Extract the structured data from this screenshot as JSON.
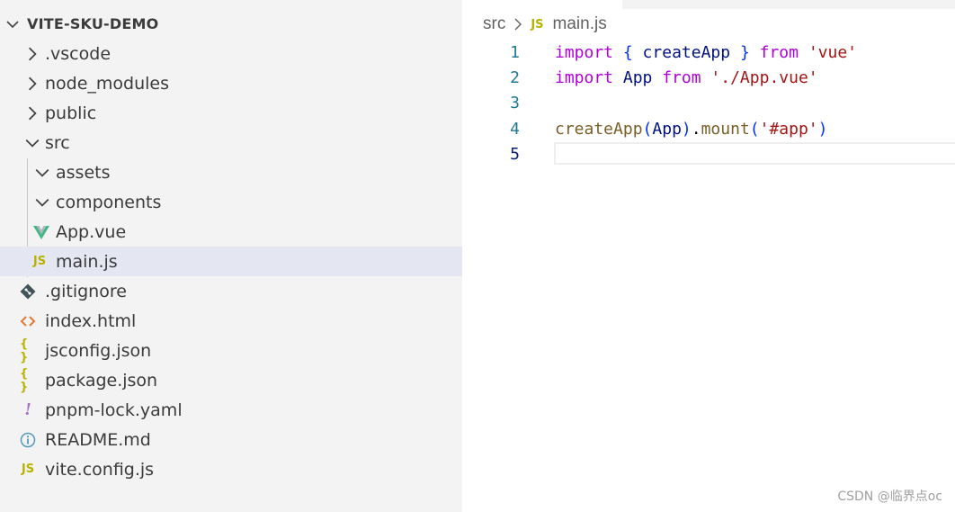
{
  "explorer": {
    "root_folder": "VITE-SKU-DEMO",
    "items": [
      {
        "label": ".vscode",
        "icon": "chevron-right-icon"
      },
      {
        "label": "node_modules",
        "icon": "chevron-right-icon"
      },
      {
        "label": "public",
        "icon": "chevron-right-icon"
      },
      {
        "label": "src",
        "icon": "chevron-down-icon"
      },
      {
        "label": "assets",
        "icon": "chevron-down-icon"
      },
      {
        "label": "components",
        "icon": "chevron-down-icon"
      },
      {
        "label": "App.vue",
        "icon": "vue-icon"
      },
      {
        "label": "main.js",
        "icon": "js-icon",
        "badge": "JS"
      },
      {
        "label": ".gitignore",
        "icon": "git-icon"
      },
      {
        "label": "index.html",
        "icon": "html-icon",
        "badge": "<>"
      },
      {
        "label": "jsconfig.json",
        "icon": "json-icon",
        "badge": "{ }"
      },
      {
        "label": "package.json",
        "icon": "json-icon",
        "badge": "{ }"
      },
      {
        "label": "pnpm-lock.yaml",
        "icon": "yaml-icon",
        "badge": "!"
      },
      {
        "label": "README.md",
        "icon": "info-icon"
      },
      {
        "label": "vite.config.js",
        "icon": "js-icon",
        "badge": "JS"
      }
    ]
  },
  "breadcrumb": {
    "folder": "src",
    "file_badge": "JS",
    "file": "main.js"
  },
  "editor": {
    "line_numbers": [
      "1",
      "2",
      "3",
      "4",
      "5"
    ],
    "lines": {
      "l1": {
        "kw1": "import",
        "ob": "{",
        "id": " createApp ",
        "cb": "}",
        "kw2": "from",
        "str": "'vue'"
      },
      "l2": {
        "kw1": "import",
        "id": " App ",
        "kw2": "from",
        "str": "'./App.vue'"
      },
      "l4": {
        "fn": "createApp",
        "op": "(",
        "id": "App",
        "cp": ")",
        "dot": ".",
        "fn2": "mount",
        "op2": "(",
        "str": "'#app'",
        "cp2": ")"
      }
    }
  },
  "watermark": "CSDN @临界点oc",
  "colors": {
    "sidebar_bg": "#f3f3f3",
    "selected_bg": "#e4e6f1",
    "keyword": "#af00db",
    "string": "#a31515",
    "function": "#795e26",
    "line_number": "#237893"
  }
}
